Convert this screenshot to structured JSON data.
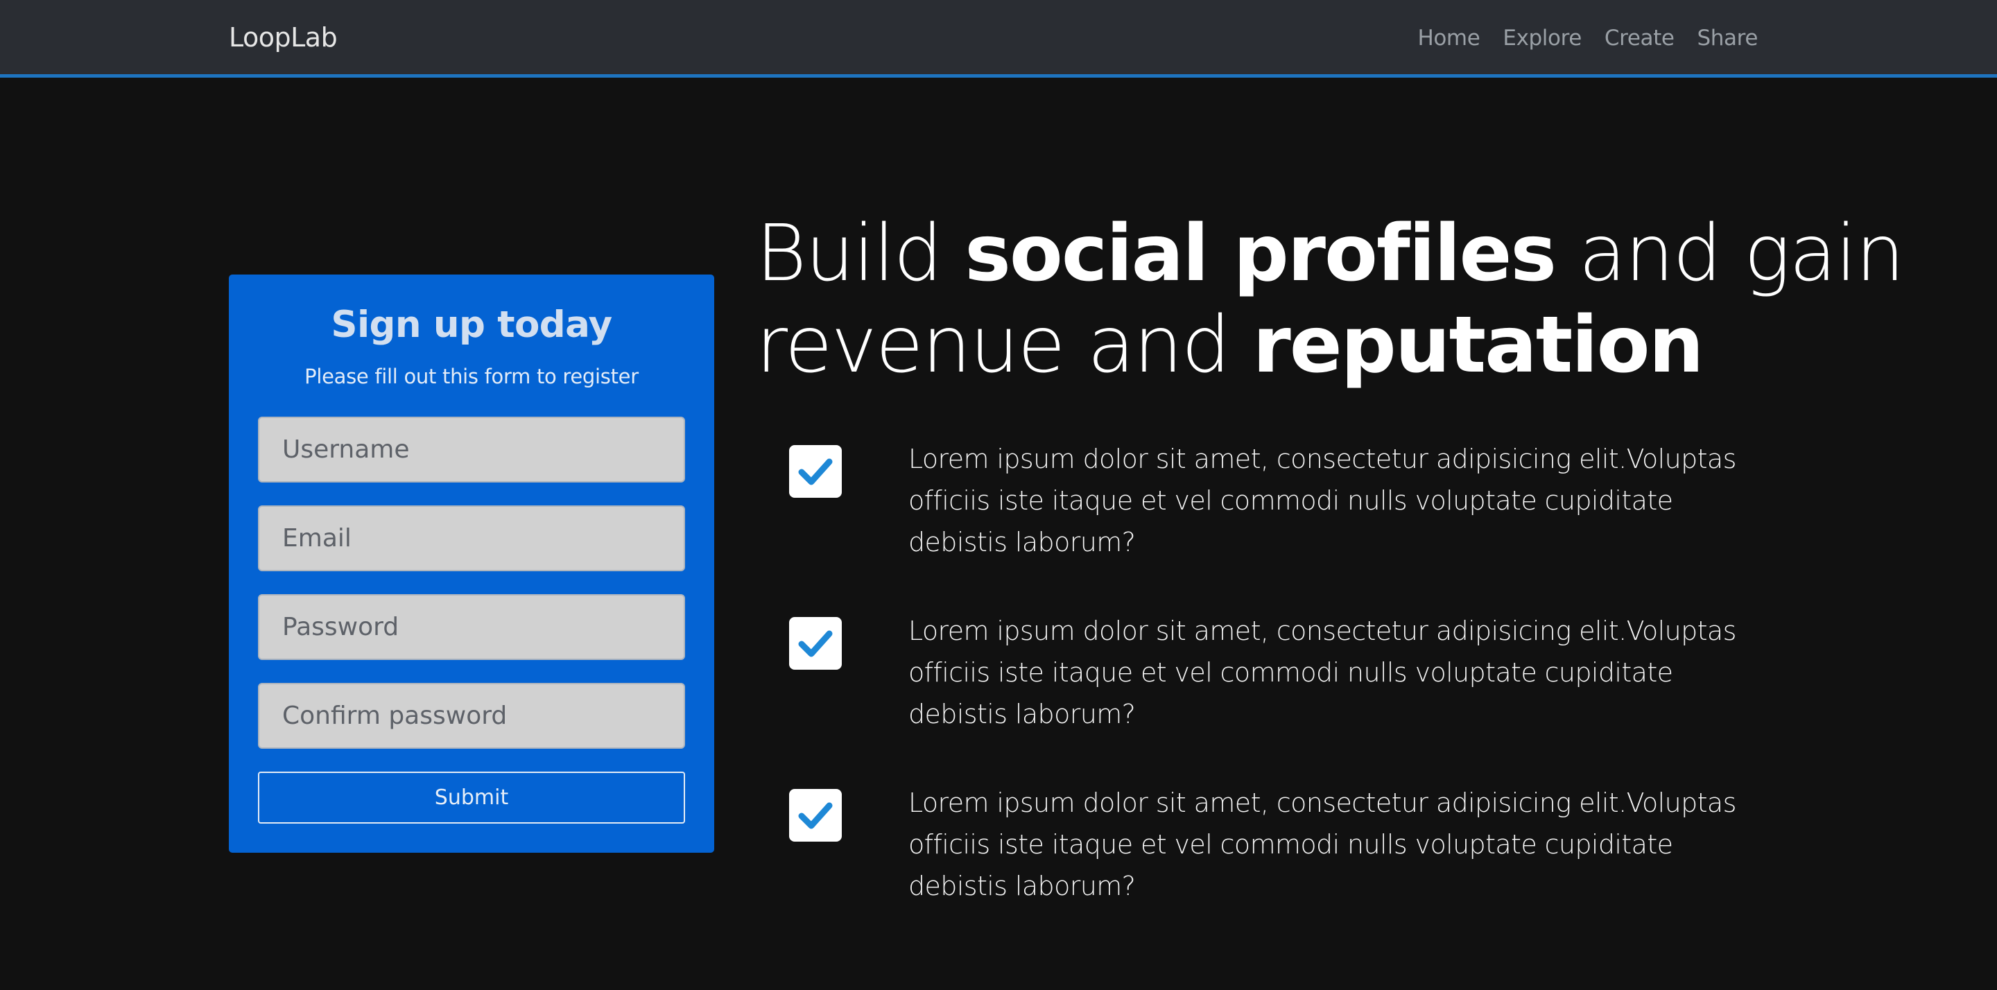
{
  "navbar": {
    "brand": "LoopLab",
    "links": [
      "Home",
      "Explore",
      "Create",
      "Share"
    ]
  },
  "signup_form": {
    "title": "Sign up today",
    "subtitle": "Please fill out this form to register",
    "username_placeholder": "Username",
    "email_placeholder": "Email",
    "password_placeholder": "Password",
    "confirm_placeholder": "Confirm password",
    "submit_label": "Submit"
  },
  "hero": {
    "line1_a": "Build ",
    "line1_bold": "social profiles",
    "line1_b": " and gain",
    "line2_a": "revenue and ",
    "line2_bold": "reputation"
  },
  "features": [
    {
      "icon": "check-icon",
      "text": "Lorem ipsum dolor sit amet, consectetur adipisicing elit.Voluptas officiis iste itaque et vel commodi nulls voluptate cupiditate debistis laborum?"
    },
    {
      "icon": "check-icon",
      "text": "Lorem ipsum dolor sit amet, consectetur adipisicing elit.Voluptas officiis iste itaque et vel commodi nulls voluptate cupiditate debistis laborum?"
    },
    {
      "icon": "check-icon",
      "text": "Lorem ipsum dolor sit amet, consectetur adipisicing elit.Voluptas officiis iste itaque et vel commodi nulls voluptate cupiditate debistis laborum?"
    }
  ],
  "colors": {
    "navbar_bg": "#2a2d33",
    "navbar_border": "#1e74c0",
    "page_bg": "#111111",
    "form_bg": "#0463d3",
    "check_color": "#1e88d6"
  }
}
